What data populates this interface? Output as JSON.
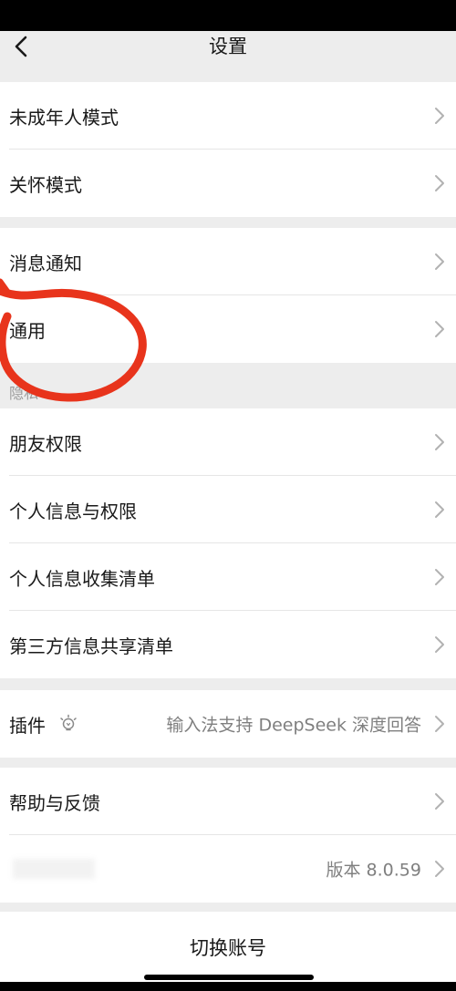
{
  "header": {
    "title": "设置",
    "back_icon": "chevron-left-icon"
  },
  "groups": {
    "g1": [
      "未成年人模式",
      "关怀模式"
    ],
    "g2": [
      "消息通知",
      "通用"
    ],
    "privacy_header": "隐私",
    "g3": [
      "朋友权限",
      "个人信息与权限",
      "个人信息收集清单",
      "第三方信息共享清单"
    ],
    "plugin": {
      "label": "插件",
      "icon": "lightbulb-icon",
      "value": "输入法支持 DeepSeek 深度回答"
    },
    "g5": {
      "help": "帮助与反馈",
      "version": "版本 8.0.59"
    }
  },
  "switch_account": "切换账号",
  "colors": {
    "annotation_circle": "#e8341c",
    "background": "#ededed",
    "chevron": "#b2b2b2"
  }
}
